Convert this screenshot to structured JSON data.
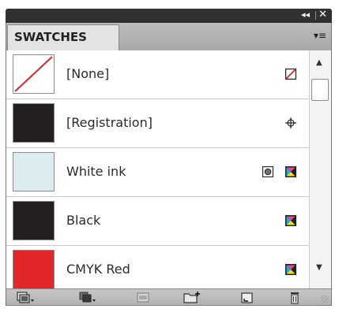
{
  "panel": {
    "title_bar": {
      "collapse_label": "◂◂",
      "close_label": "✕"
    },
    "tab": {
      "label": "SWATCHES"
    },
    "menu_label": "▾≡"
  },
  "swatches": [
    {
      "name": "[None]",
      "color": "#ffffff",
      "type": "none",
      "mode_icon": "none-icon"
    },
    {
      "name": "[Registration]",
      "color": "#231f20",
      "type": "registration",
      "mode_icon": "registration-icon"
    },
    {
      "name": "White ink",
      "color": "#dcedf1",
      "type": "spot",
      "mode_icon": "cmyk-icon",
      "spot_icon": "spot-color-icon"
    },
    {
      "name": "Black",
      "color": "#231f20",
      "type": "process",
      "mode_icon": "cmyk-icon"
    },
    {
      "name": "CMYK Red",
      "color": "#e3262a",
      "type": "process",
      "mode_icon": "cmyk-icon"
    }
  ],
  "scrollbar": {
    "up_label": "▲",
    "down_label": "▼",
    "position_fraction": 0.0
  },
  "bottom_toolbar": [
    {
      "name": "show-all-swatches-icon"
    },
    {
      "name": "show-color-swatches-icon"
    },
    {
      "name": "show-gradient-swatches-icon"
    },
    {
      "name": "new-color-group-icon"
    },
    {
      "name": "new-swatch-icon"
    },
    {
      "name": "delete-swatch-icon"
    }
  ]
}
